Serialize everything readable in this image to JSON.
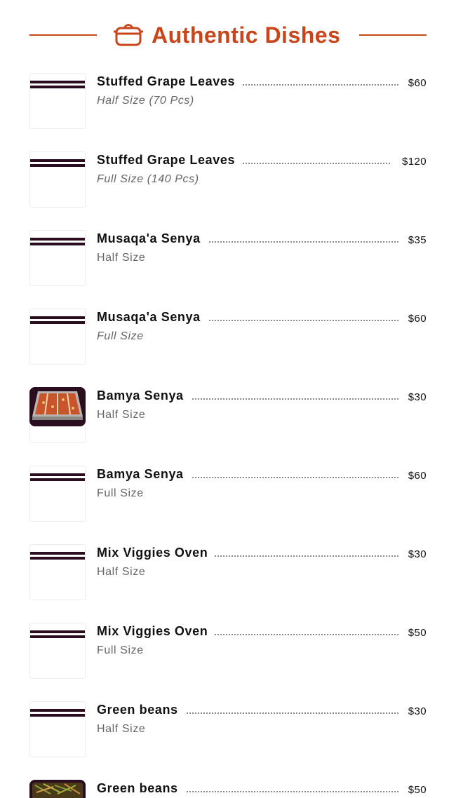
{
  "section": {
    "title": "Authentic Dishes",
    "icon": "cooking-pot-icon",
    "accent_color": "#c9461a"
  },
  "items": [
    {
      "name": "Stuffed Grape Leaves",
      "desc": "Half Size (70 Pcs)",
      "price": "$60"
    },
    {
      "name": "Stuffed Grape Leaves",
      "desc": "Full Size (140 Pcs)",
      "price": "$120"
    },
    {
      "name": "Musaqa'a Senya",
      "desc": "Half Size",
      "price": "$35"
    },
    {
      "name": "Musaqa'a Senya",
      "desc": "Full Size",
      "price": "$60"
    },
    {
      "name": "Bamya Senya",
      "desc": "Half Size",
      "price": "$30"
    },
    {
      "name": "Bamya Senya",
      "desc": "Full Size",
      "price": "$60"
    },
    {
      "name": "Mix Viggies Oven",
      "desc": "Half Size",
      "price": "$30"
    },
    {
      "name": "Mix Viggies Oven",
      "desc": "Full Size",
      "price": "$50"
    },
    {
      "name": "Green beans",
      "desc": "Half Size",
      "price": "$30"
    },
    {
      "name": "Green beans",
      "desc": "",
      "price": "$50"
    }
  ]
}
